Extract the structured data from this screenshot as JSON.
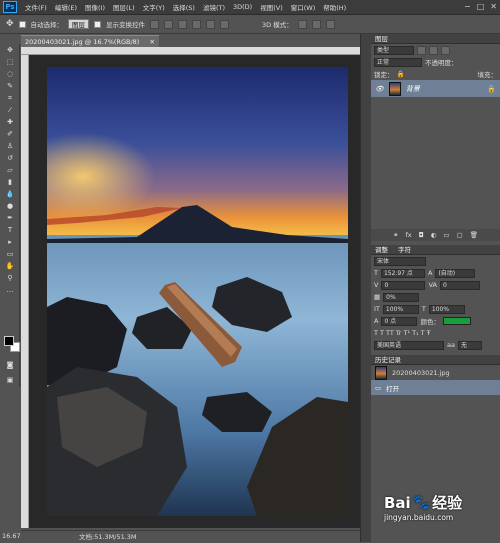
{
  "app": {
    "logo": "Ps"
  },
  "menu": [
    "文件(F)",
    "编辑(E)",
    "图像(I)",
    "图层(L)",
    "文字(Y)",
    "选择(S)",
    "滤镜(T)",
    "3D(D)",
    "视图(V)",
    "窗口(W)",
    "帮助(H)"
  ],
  "window_controls": [
    "−",
    "□",
    "✕"
  ],
  "options": {
    "auto_select_label": "自动选择：",
    "auto_select_value": "图层",
    "show_transform_label": "显示变换控件",
    "mode_3d": "3D 模式："
  },
  "document": {
    "tab_title": "20200403021.jpg @ 16.7%(RGB/8)",
    "tab_close": "✕"
  },
  "status": {
    "zoom": "16.67%",
    "doc_size": "文档:51.3M/51.3M"
  },
  "layers_panel": {
    "tab": "图层",
    "filter": "类型",
    "blend_mode": "正常",
    "opacity": "不透明度：",
    "lock": "锁定：",
    "fill": "填充：",
    "layer_name": "背景"
  },
  "char_panel": {
    "tabs": [
      "调整",
      "字符"
    ],
    "font_family": "宋体",
    "font_size": "152.97 点",
    "leading": "(自动)",
    "kerning": "0",
    "tracking": "0%",
    "vscale": "100%",
    "hscale": "100%",
    "baseline": "0 点",
    "color": "颜色：",
    "language": "美国英语",
    "aa_label": "aa",
    "aa_value": "无"
  },
  "history_panel": {
    "tab": "历史记录",
    "items": [
      "20200403021.jpg",
      "打开"
    ]
  },
  "colors": {
    "char_color": "#1a9e3c"
  },
  "watermark": {
    "brand": "Bai",
    "brand2": "经验",
    "url": "jingyan.baidu.com"
  }
}
